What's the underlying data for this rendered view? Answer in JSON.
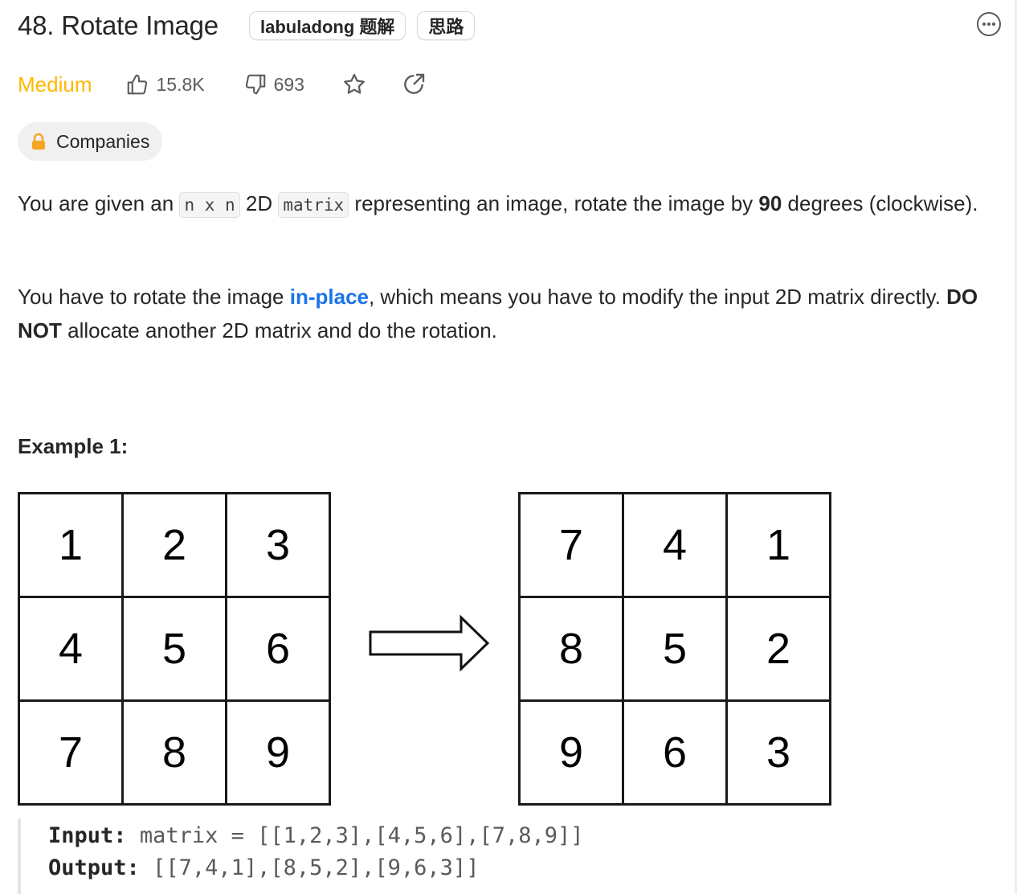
{
  "problem": {
    "title": "48. Rotate Image",
    "tags": [
      "labuladong 题解",
      "思路"
    ],
    "difficulty": "Medium",
    "likes": "15.8K",
    "dislikes": "693",
    "companies_label": "Companies"
  },
  "description": {
    "p1_text1": "You are given an ",
    "p1_code1": "n x n",
    "p1_text2": " 2D ",
    "p1_code2": "matrix",
    "p1_text3": " representing an image, rotate the image by ",
    "p1_bold": "90",
    "p1_text4": " degrees (clockwise).",
    "p2_text1": "You have to rotate the image ",
    "p2_link": "in-place",
    "p2_text2": ", which means you have to modify the input 2D matrix directly. ",
    "p2_bold": "DO NOT",
    "p2_text3": " allocate another 2D matrix and do the rotation."
  },
  "example": {
    "title": "Example 1:",
    "input_matrix": [
      [
        "1",
        "2",
        "3"
      ],
      [
        "4",
        "5",
        "6"
      ],
      [
        "7",
        "8",
        "9"
      ]
    ],
    "output_matrix": [
      [
        "7",
        "4",
        "1"
      ],
      [
        "8",
        "5",
        "2"
      ],
      [
        "9",
        "6",
        "3"
      ]
    ],
    "input_label": "Input:",
    "input_value": "matrix = [[1,2,3],[4,5,6],[7,8,9]]",
    "output_label": "Output:",
    "output_value": "[[7,4,1],[8,5,2],[9,6,3]]"
  },
  "colors": {
    "difficulty_medium": "#ffb800",
    "link": "#1a73e8",
    "lock": "#f5a623"
  },
  "icons": {
    "more": "more-horizontal-icon",
    "like": "thumbs-up-icon",
    "dislike": "thumbs-down-icon",
    "favorite": "star-icon",
    "share": "share-icon",
    "lock": "lock-icon",
    "arrow": "right-arrow-icon"
  }
}
